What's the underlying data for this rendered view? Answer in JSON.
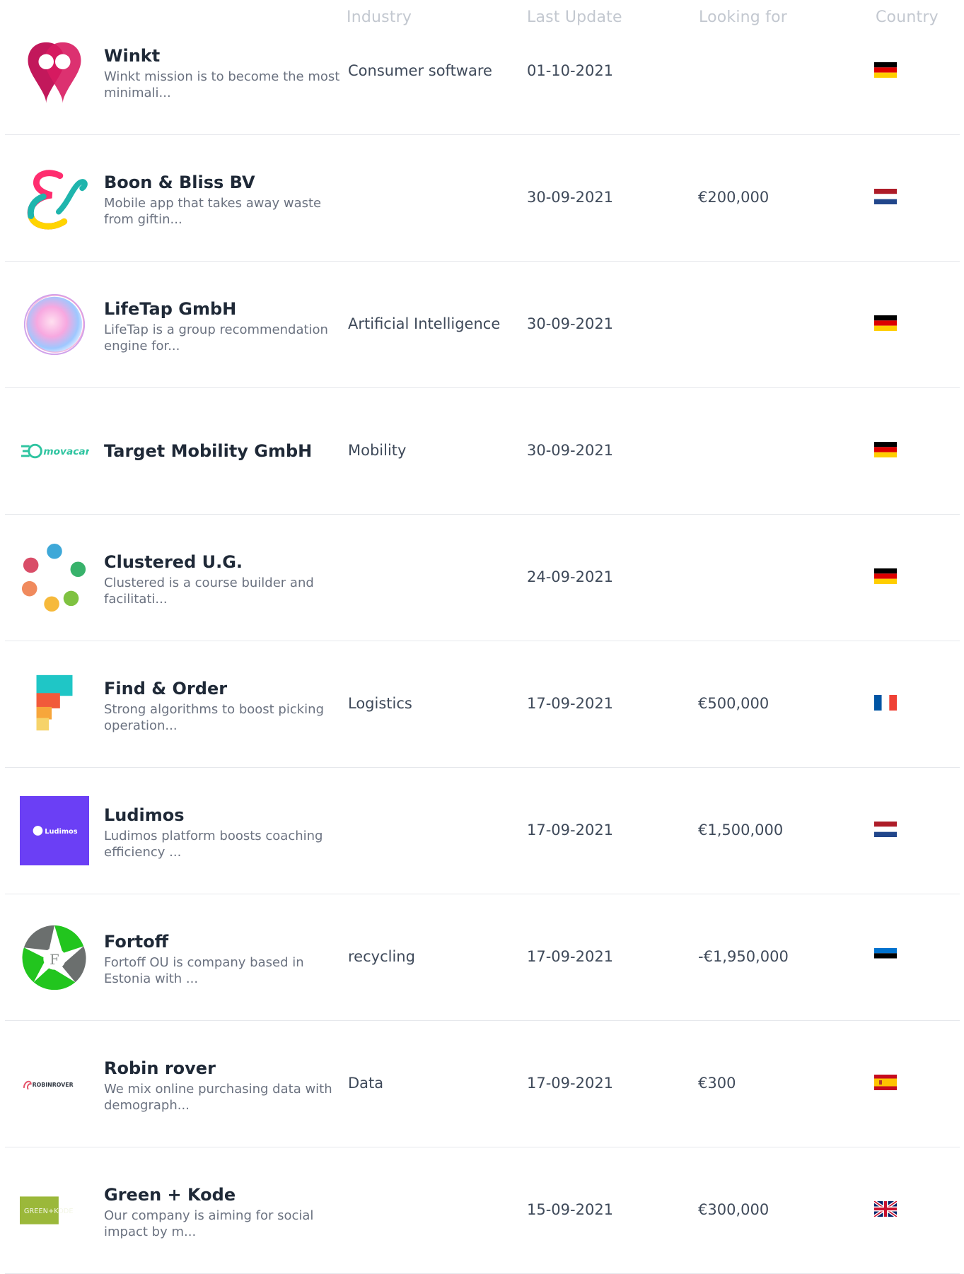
{
  "columns": {
    "industry": "Industry",
    "last_update": "Last Update",
    "looking_for": "Looking for",
    "country": "Country"
  },
  "startups": [
    {
      "name": "Winkt",
      "description": "Winkt mission is to become the most minimali...",
      "industry": "Consumer software",
      "last_update": "01-10-2021",
      "looking_for": "",
      "country_flag": "de",
      "logo_icon": "winkt-logo-icon"
    },
    {
      "name": "Boon & Bliss BV",
      "description": "Mobile app that takes away waste from giftin...",
      "industry": "",
      "last_update": "30-09-2021",
      "looking_for": "€200,000",
      "country_flag": "nl",
      "logo_icon": "boon-bliss-logo-icon"
    },
    {
      "name": "LifeTap GmbH",
      "description": "LifeTap is a group recommendation engine for...",
      "industry": "Artificial Intelligence",
      "last_update": "30-09-2021",
      "looking_for": "",
      "country_flag": "de",
      "logo_icon": "lifetap-logo-icon"
    },
    {
      "name": "Target Mobility GmbH",
      "description": "",
      "industry": "Mobility",
      "last_update": "30-09-2021",
      "looking_for": "",
      "country_flag": "de",
      "logo_icon": "movacar-logo-icon",
      "logo_text": "movacar"
    },
    {
      "name": "Clustered U.G.",
      "description": "Clustered is a course builder and facilitati...",
      "industry": "",
      "last_update": "24-09-2021",
      "looking_for": "",
      "country_flag": "de",
      "logo_icon": "clustered-logo-icon"
    },
    {
      "name": "Find & Order",
      "description": "Strong algorithms to boost picking operation...",
      "industry": "Logistics",
      "last_update": "17-09-2021",
      "looking_for": "€500,000",
      "country_flag": "fr",
      "logo_icon": "find-order-logo-icon"
    },
    {
      "name": "Ludimos",
      "description": "Ludimos platform boosts coaching efficiency ...",
      "industry": "",
      "last_update": "17-09-2021",
      "looking_for": "€1,500,000",
      "country_flag": "nl",
      "logo_icon": "ludimos-logo-icon",
      "logo_text": "Ludimos"
    },
    {
      "name": "Fortoff",
      "description": "Fortoff OU is company based in Estonia with ...",
      "industry": "recycling",
      "last_update": "17-09-2021",
      "looking_for": "-€1,950,000",
      "country_flag": "ee",
      "logo_icon": "fortoff-logo-icon",
      "logo_text": "F"
    },
    {
      "name": "Robin rover",
      "description": "We mix online purchasing data with demograph...",
      "industry": "Data",
      "last_update": "17-09-2021",
      "looking_for": "€300",
      "country_flag": "es",
      "logo_icon": "robinrover-logo-icon",
      "logo_text": "ROBINROVER"
    },
    {
      "name": "Green + Kode",
      "description": "Our company is aiming for social impact by m...",
      "industry": "",
      "last_update": "15-09-2021",
      "looking_for": "€300,000",
      "country_flag": "gb",
      "logo_icon": "greenkode-logo-icon",
      "logo_text": "GREEN+KODE"
    }
  ]
}
